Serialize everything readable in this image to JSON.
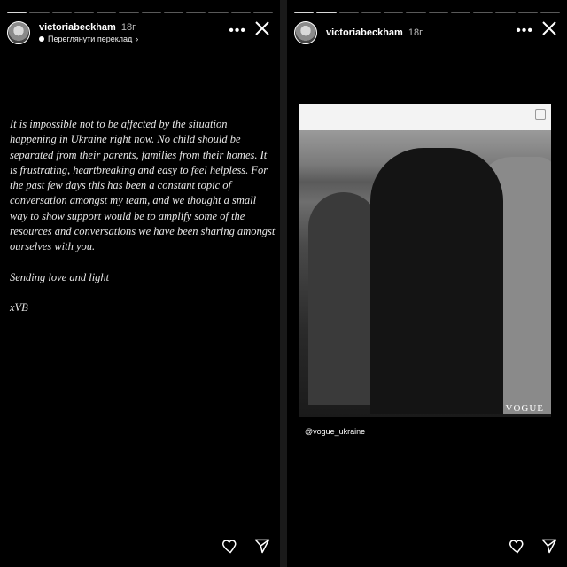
{
  "left_story": {
    "username": "victoriabeckham",
    "time": "18г",
    "translate_link": "Переглянути переклад",
    "paragraphs": [
      "It is impossible not to be affected by the situation happening in Ukraine right now. No child should be separated from their parents, families from their homes. It is frustrating, heartbreaking and easy to feel helpless. For the past few days this has been a constant topic of conversation amongst my team, and we thought a small way to show support would be to amplify some of the resources and conversations we have been sharing amongst ourselves with you.",
      "Sending love and light",
      "xVB"
    ],
    "progress_total": 12,
    "progress_done": 1
  },
  "right_story": {
    "username": "victoriabeckham",
    "time": "18г",
    "mention": "@vogue_ukraine",
    "watermark": "VOGUE",
    "progress_total": 12,
    "progress_done": 2
  }
}
